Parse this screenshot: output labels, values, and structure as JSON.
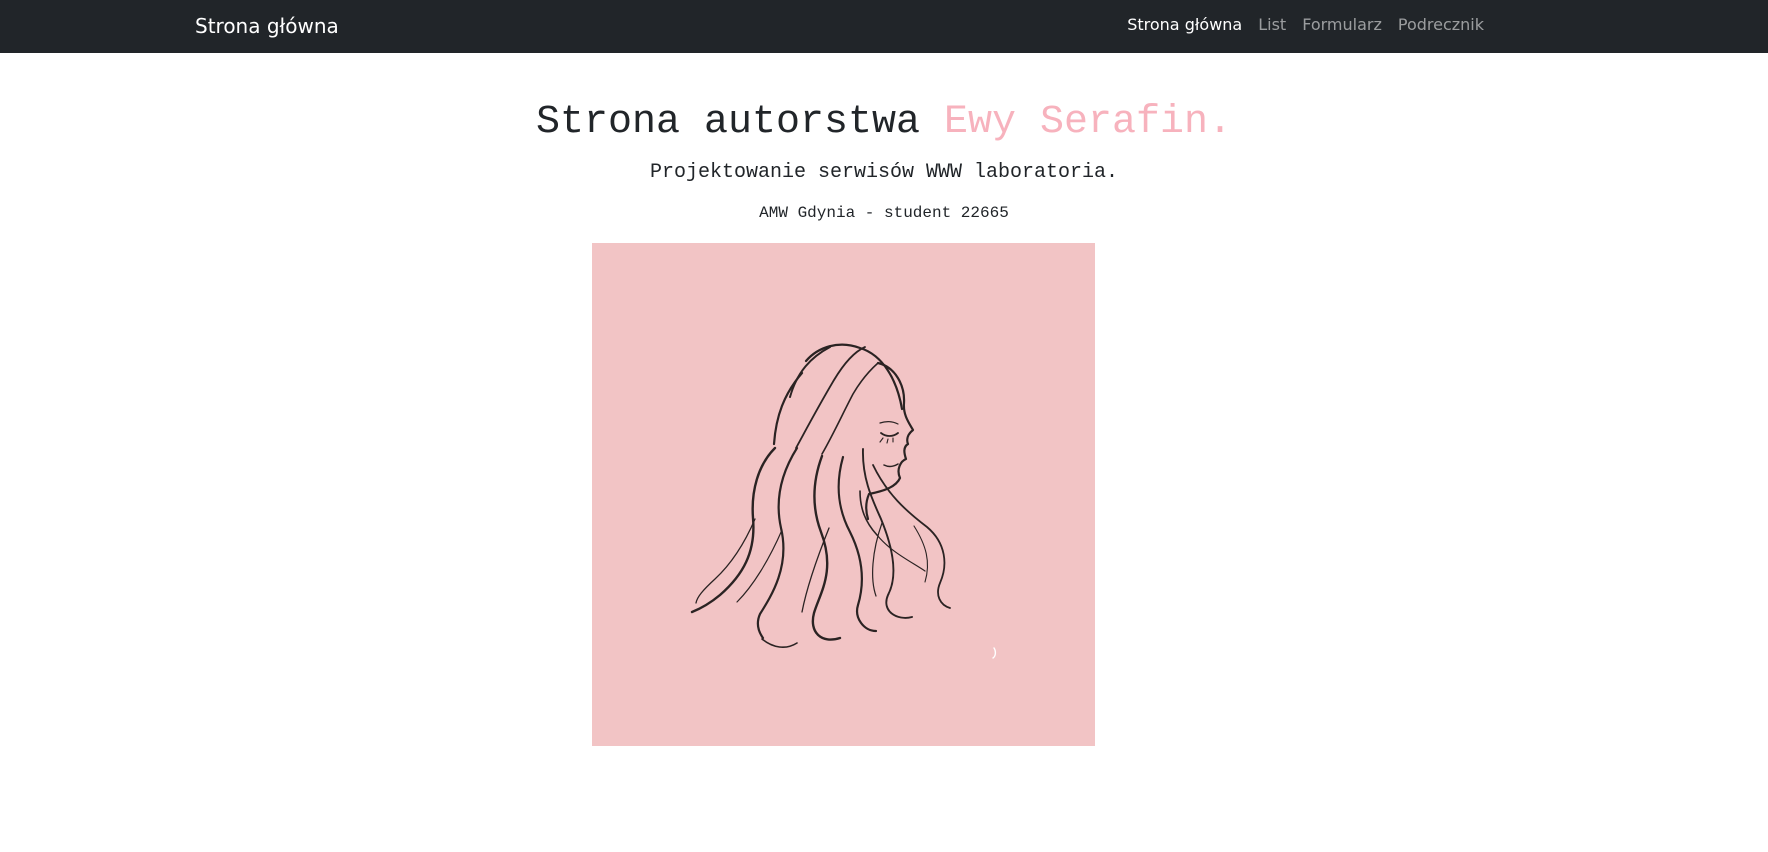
{
  "navbar": {
    "brand": "Strona główna",
    "links": [
      {
        "label": "Strona główna",
        "active": true
      },
      {
        "label": "List",
        "active": false
      },
      {
        "label": "Formularz",
        "active": false
      },
      {
        "label": "Podrecznik",
        "active": false
      }
    ]
  },
  "hero": {
    "title_prefix": "Strona autorstwa ",
    "title_accent": "Ewy Serafin.",
    "subtitle": "Projektowanie serwisów WWW laboratoria.",
    "meta": "AMW Gdynia - student 22665"
  },
  "image": {
    "subject": "woman-profile-line-art",
    "background_color": "#f2c4c5"
  },
  "colors": {
    "navbar_bg": "#212529",
    "accent": "#f7b2bd",
    "text": "#212529"
  }
}
